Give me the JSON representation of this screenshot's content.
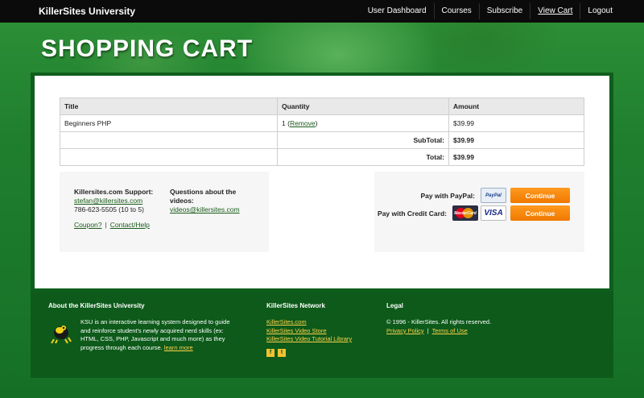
{
  "brand": "KillerSites University",
  "nav": [
    "User Dashboard",
    "Courses",
    "Subscribe",
    "View Cart",
    "Logout"
  ],
  "page_title": "SHOPPING CART",
  "cart": {
    "headers": [
      "Title",
      "Quantity",
      "Amount"
    ],
    "item": {
      "title": "Beginners PHP",
      "qty": "1",
      "remove": "Remove",
      "amount": "$39.99"
    },
    "subtotal_label": "SubTotal:",
    "subtotal": "$39.99",
    "total_label": "Total:",
    "total": "$39.99"
  },
  "support": {
    "heading": "Killersites.com Support:",
    "email": "stefan@killersites.com",
    "phone": "786-623-5505 (10 to 5)",
    "videos_heading": "Questions about the videos:",
    "videos_email": "videos@killersites.com",
    "coupon": "Coupon?",
    "contact": "Contact/Help"
  },
  "payment": {
    "paypal_label": "Pay with PayPal:",
    "paypal_badge": "PayPal",
    "credit_label": "Pay with Credit Card:",
    "mc_badge": "MasterCard",
    "visa_badge": "VISA",
    "continue": "Continue"
  },
  "footer": {
    "about_heading": "About the KillerSites University",
    "about_text": "KSU is an interactive learning system designed to guide and reinforce student's newly acquired nerd skills (ex: HTML, CSS, PHP, Javascript and much more) as they progress through each course.",
    "learn_more": "learn more",
    "network_heading": "KillerSites Network",
    "network_links": [
      "KillerSites.com",
      "KillerSites Video Store",
      "KillerSites Video Tutorial Library"
    ],
    "legal_heading": "Legal",
    "copyright": "© 1996 - KillerSites. All rights reserved.",
    "privacy": "Privacy Policy",
    "terms": "Terms of Use"
  }
}
